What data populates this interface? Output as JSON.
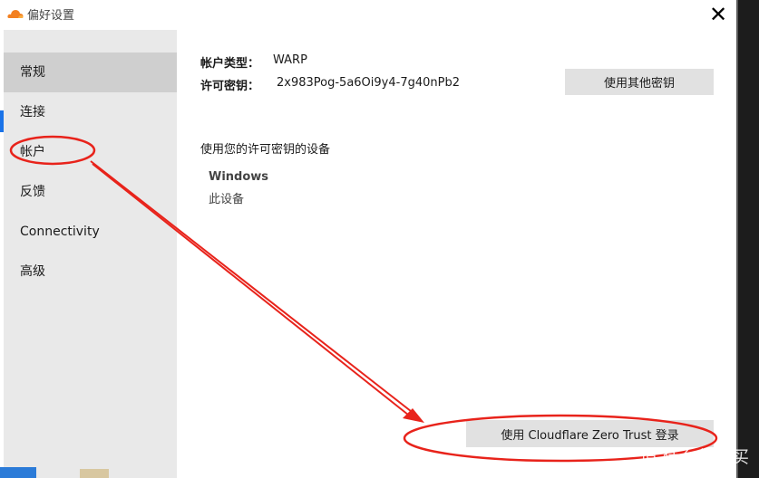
{
  "window": {
    "title": "偏好设置",
    "close_glyph": "✕",
    "app_icon": "cloudflare-cloud-icon"
  },
  "sidebar": {
    "items": [
      {
        "label": "常规",
        "selected": true
      },
      {
        "label": "连接",
        "selected": false
      },
      {
        "label": "帐户",
        "selected": false
      },
      {
        "label": "反馈",
        "selected": false
      },
      {
        "label": "Connectivity",
        "selected": false
      },
      {
        "label": "高级",
        "selected": false
      }
    ]
  },
  "account": {
    "type_label": "帐户类型：",
    "type_value": "WARP",
    "key_label": "许可密钥：",
    "key_value": "2x983Pog-5a6Oi9y4-7g40nPb2",
    "other_key_button": "使用其他密钥",
    "devices_title": "使用您的许可密钥的设备",
    "device_name": "Windows",
    "device_desc": "此设备",
    "zero_trust_button": "使用 Cloudflare Zero Trust 登录"
  },
  "watermark": "值 什么值得买",
  "colors": {
    "accent": "#1a73e8",
    "annotation": "#e8231b",
    "sidebar_bg": "#e9e9e9",
    "sidebar_selected": "#cfcfcf",
    "button_bg": "#e1e1e1",
    "cloudflare_orange": "#f38020"
  }
}
